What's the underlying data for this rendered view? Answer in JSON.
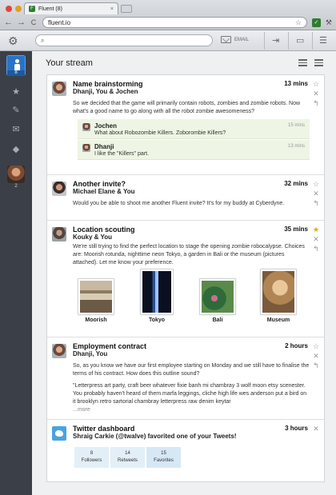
{
  "browser": {
    "tab_title": "Fluent (8)",
    "url": "fluent.io",
    "tab_close": "×",
    "back": "←",
    "forward": "→",
    "reload": "C",
    "star": "☆",
    "ext_label": "✓",
    "wrench": "⚒"
  },
  "header": {
    "gear": "⚙",
    "search_icon": "⌕",
    "email_label": "EMAIL",
    "share_icon": "⇥",
    "folder_icon": "▭",
    "menu_icon": "☰"
  },
  "sidebar": {
    "me_badge": "8",
    "star": "★",
    "clip": "✎",
    "mail": "✉",
    "tag": "◆",
    "user2_badge": "2"
  },
  "stream": {
    "title": "Your stream"
  },
  "items": [
    {
      "title": "Name brainstorming",
      "participants": "Dhanji, You & Jochen",
      "time": "13 mins",
      "body": "So we decided that the game will primarily contain robots, zombies and zombie robots. Now what's a good name to go along with all the robot zombie awesomeness?",
      "replies": [
        {
          "name": "Jochen",
          "time": "15 mins",
          "text": "What about Robozombie Killers. Zoborombie Killers?"
        },
        {
          "name": "Dhanji",
          "time": "13 mins",
          "text": "I like the \"Killers\" part."
        }
      ]
    },
    {
      "title": "Another invite?",
      "participants": "Michael Elane & You",
      "time": "32 mins",
      "body": "Would you be able to shoot me another Fluent invite? It's for my buddy at Cyberdyne."
    },
    {
      "title": "Location scouting",
      "participants": "Kouky & You",
      "time": "35 mins",
      "body": "We're still trying to find the perfect location to stage the opening zombie robocalypse. Choices are: Moorish rotunda, nighttime neon Tokyo, a garden in Bali or the museum (pictures attached). Let me know your preference.",
      "locations": [
        {
          "label": "Moorish"
        },
        {
          "label": "Tokyo"
        },
        {
          "label": "Bali"
        },
        {
          "label": "Museum"
        }
      ]
    },
    {
      "title": "Employment contract",
      "participants": "Dhanji, You",
      "time": "2 hours",
      "body": "So, as you know we have our first employee starting on Monday and we still have to finalise the terms of his contract. How does this outline sound?",
      "body2": "\"Letterpress art party, craft beer whatever fixie banh mi chambray 3 wolf moon etsy scenester. You probably haven't heard of them marfa leggings, cliche high life wes anderson put a bird on it brooklyn retro sartorial chambray letterpress raw denim keytar",
      "more": "...more"
    },
    {
      "title": "Twitter dashboard",
      "participants": "Shraig Carkie (@twalve) favorited one of your Tweets!",
      "time": "3 hours",
      "stats": [
        {
          "value": "8",
          "label": "Followers"
        },
        {
          "value": "14",
          "label": "Retweets"
        },
        {
          "value": "15",
          "label": "Favorites"
        }
      ]
    }
  ],
  "actions": {
    "star": "☆",
    "star_on": "★",
    "close": "✕",
    "reply": "↰"
  },
  "colors": {
    "sidebar": "#3b4048",
    "accent": "#2b73c6",
    "reply_bg": "#eef5e4"
  }
}
